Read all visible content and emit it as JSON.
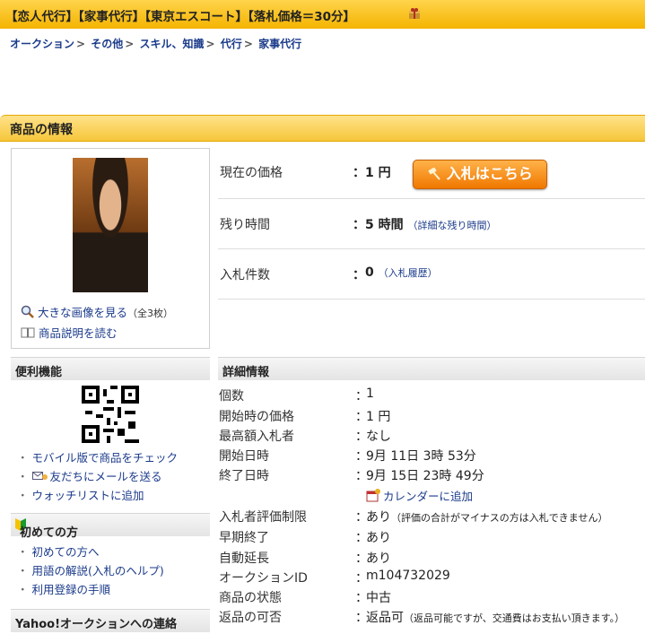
{
  "title": "【恋人代行】【家事代行】【東京エスコート】【落札価格＝30分】",
  "breadcrumb": [
    "オークション",
    "その他",
    "スキル、知識",
    "代行",
    "家事代行"
  ],
  "section_title": "商品の情報",
  "image_links": {
    "large": "大きな画像を見る",
    "large_count": "（全3枚）",
    "desc": "商品説明を読む"
  },
  "summary": {
    "price_label": "現在の価格",
    "price_value": "1 円",
    "bid_button": "入札はこちら",
    "time_label": "残り時間",
    "time_value": "5 時間",
    "time_link": "（詳細な残り時間）",
    "bids_label": "入札件数",
    "bids_value": "0",
    "bids_link": "（入札履歴）"
  },
  "convenience": {
    "title": "便利機能",
    "items": [
      "モバイル版で商品をチェック",
      "友だちにメールを送る",
      "ウォッチリストに追加"
    ]
  },
  "beginner": {
    "title": "初めての方",
    "items": [
      "初めての方へ",
      "用語の解説(入札のヘルプ)",
      "利用登録の手順"
    ]
  },
  "contact_title": "Yahoo!オークションへの連絡",
  "details": {
    "title": "詳細情報",
    "rows": [
      {
        "label": "個数",
        "value": "1"
      },
      {
        "label": "開始時の価格",
        "value": "1 円"
      },
      {
        "label": "最高額入札者",
        "value": "なし"
      },
      {
        "label": "開始日時",
        "value": "9月 11日 3時 53分"
      },
      {
        "label": "終了日時",
        "value": "9月 15日 23時 49分"
      },
      {
        "label": "入札者評価制限",
        "value": "あり",
        "note": "（評価の合計がマイナスの方は入札できません）"
      },
      {
        "label": "早期終了",
        "value": "あり"
      },
      {
        "label": "自動延長",
        "value": "あり"
      },
      {
        "label": "オークションID",
        "value": "m104732029"
      },
      {
        "label": "商品の状態",
        "value": "中古"
      },
      {
        "label": "返品の可否",
        "value": "返品可",
        "note": "（返品可能ですが、交通費はお支払い頂きます。）"
      }
    ],
    "calendar": "カレンダーに追加",
    "colon": "："
  }
}
